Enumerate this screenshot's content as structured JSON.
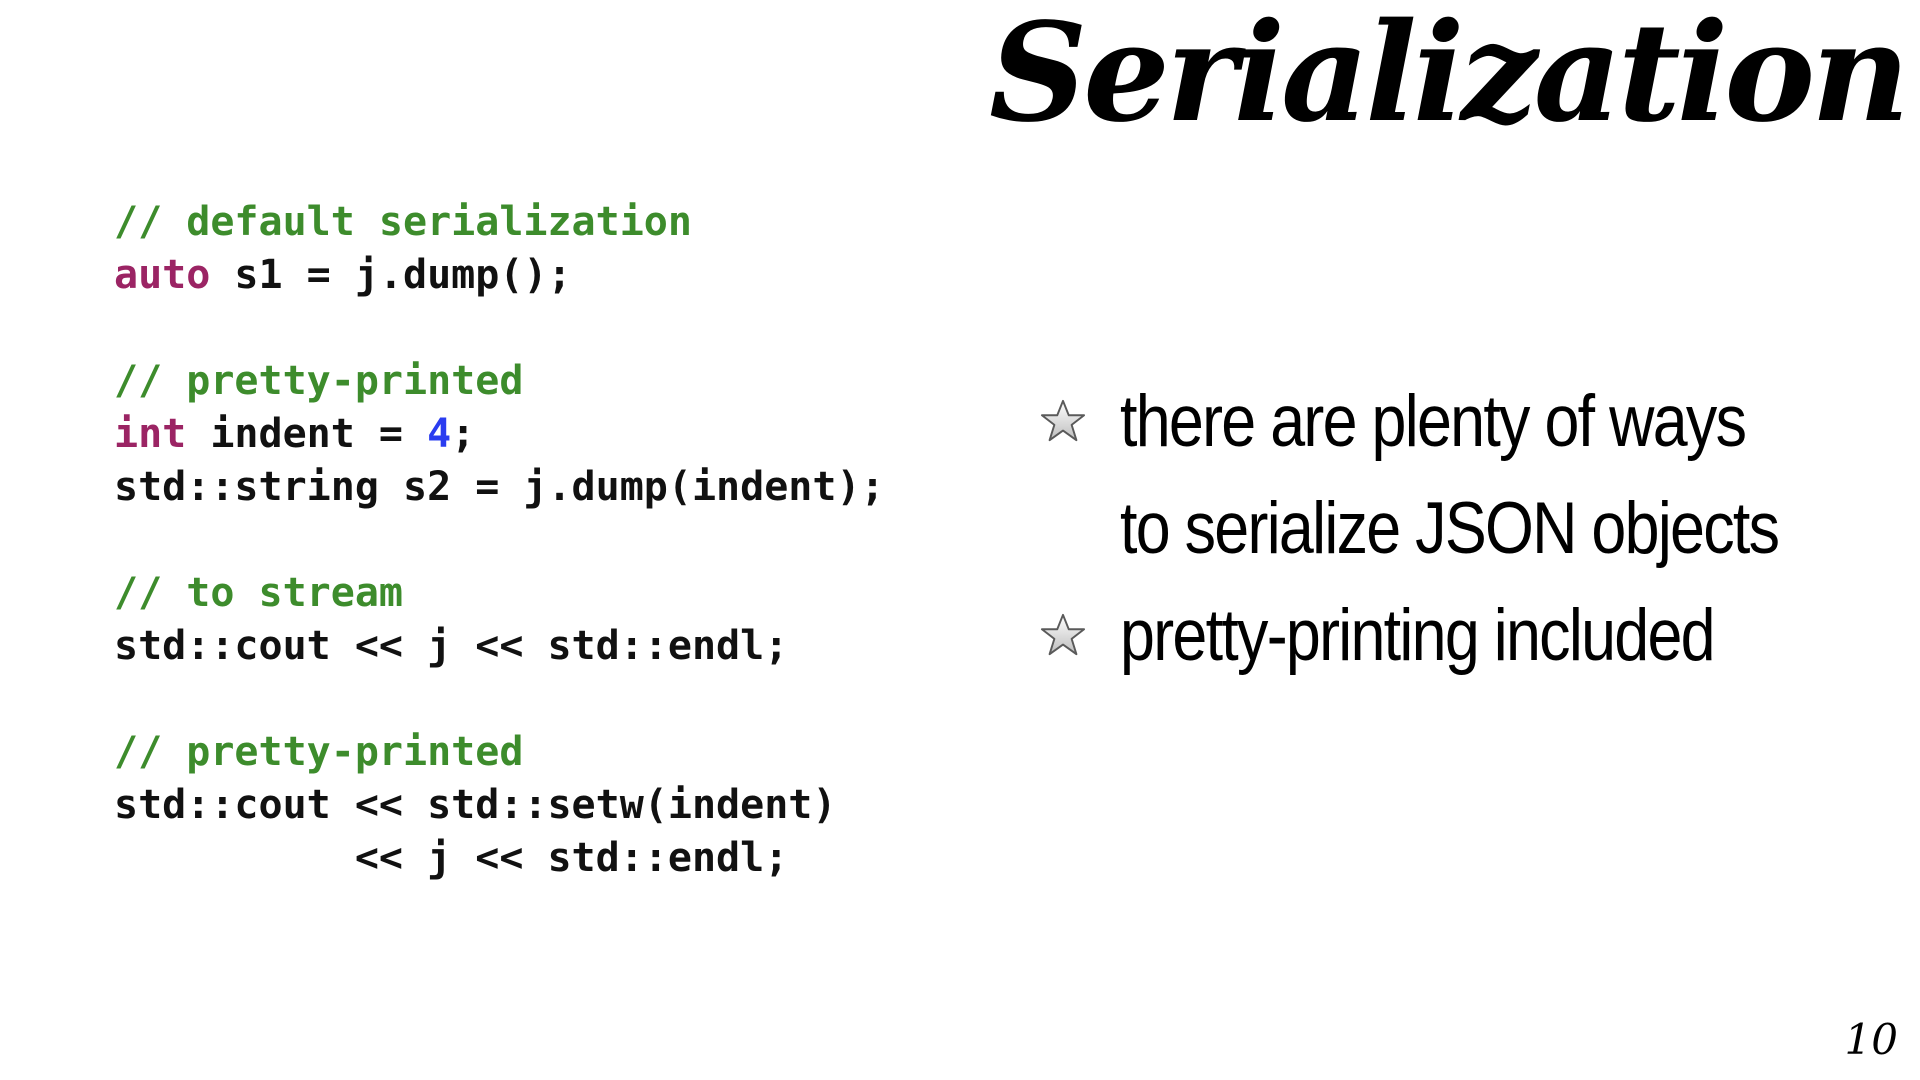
{
  "slide": {
    "title": "Serialization",
    "page_number": "10"
  },
  "code": {
    "lines": [
      [
        {
          "t": "// default serialization",
          "k": "comment"
        }
      ],
      [
        {
          "t": "auto",
          "k": "keyword"
        },
        {
          "t": " s1 = j.dump();",
          "k": "plain"
        }
      ],
      [],
      [
        {
          "t": "// pretty-printed",
          "k": "comment"
        }
      ],
      [
        {
          "t": "int",
          "k": "keyword"
        },
        {
          "t": " indent = ",
          "k": "plain"
        },
        {
          "t": "4",
          "k": "number"
        },
        {
          "t": ";",
          "k": "plain"
        }
      ],
      [
        {
          "t": "std::string s2 = j.dump(indent);",
          "k": "plain"
        }
      ],
      [],
      [
        {
          "t": "// to stream",
          "k": "comment"
        }
      ],
      [
        {
          "t": "std::cout << j << std::endl;",
          "k": "plain"
        }
      ],
      [],
      [
        {
          "t": "// pretty-printed",
          "k": "comment"
        }
      ],
      [
        {
          "t": "std::cout << std::setw(indent)",
          "k": "plain"
        }
      ],
      [
        {
          "t": "          << j << std::endl;",
          "k": "plain"
        }
      ]
    ]
  },
  "bullets": [
    {
      "icon": "star-icon",
      "text": "there are plenty of ways\nto serialize JSON objects"
    },
    {
      "icon": "star-icon",
      "text": "pretty-printing included"
    }
  ],
  "colors": {
    "comment": "#3d8c2c",
    "keyword": "#9b2464",
    "number": "#2a3cf0",
    "text": "#111111"
  }
}
